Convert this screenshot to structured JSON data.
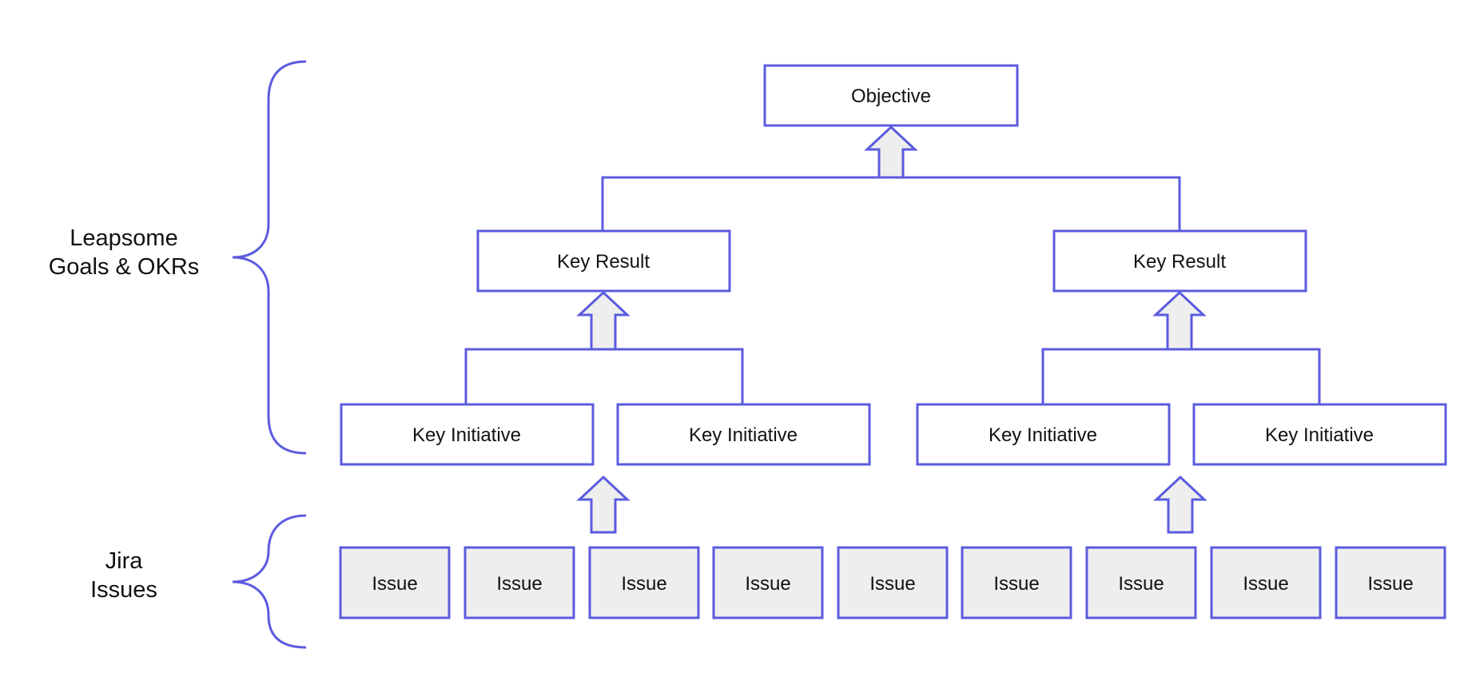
{
  "colors": {
    "stroke": "#5B5BE0",
    "issue_fill": "#EEEEEE",
    "arrow_fill": "#EEEEEE",
    "box_fill": "#FFFFFF",
    "text": "#111111"
  },
  "groups": {
    "okr": {
      "lines": [
        "Leapsome",
        "Goals & OKRs"
      ]
    },
    "jira": {
      "lines": [
        "Jira",
        "Issues"
      ]
    }
  },
  "objective": {
    "label": "Objective"
  },
  "key_results": [
    {
      "label": "Key Result"
    },
    {
      "label": "Key Result"
    }
  ],
  "key_initiatives": [
    {
      "label": "Key Initiative"
    },
    {
      "label": "Key Initiative"
    },
    {
      "label": "Key Initiative"
    },
    {
      "label": "Key Initiative"
    }
  ],
  "issues": [
    {
      "label": "Issue"
    },
    {
      "label": "Issue"
    },
    {
      "label": "Issue"
    },
    {
      "label": "Issue"
    },
    {
      "label": "Issue"
    },
    {
      "label": "Issue"
    },
    {
      "label": "Issue"
    },
    {
      "label": "Issue"
    },
    {
      "label": "Issue"
    }
  ]
}
